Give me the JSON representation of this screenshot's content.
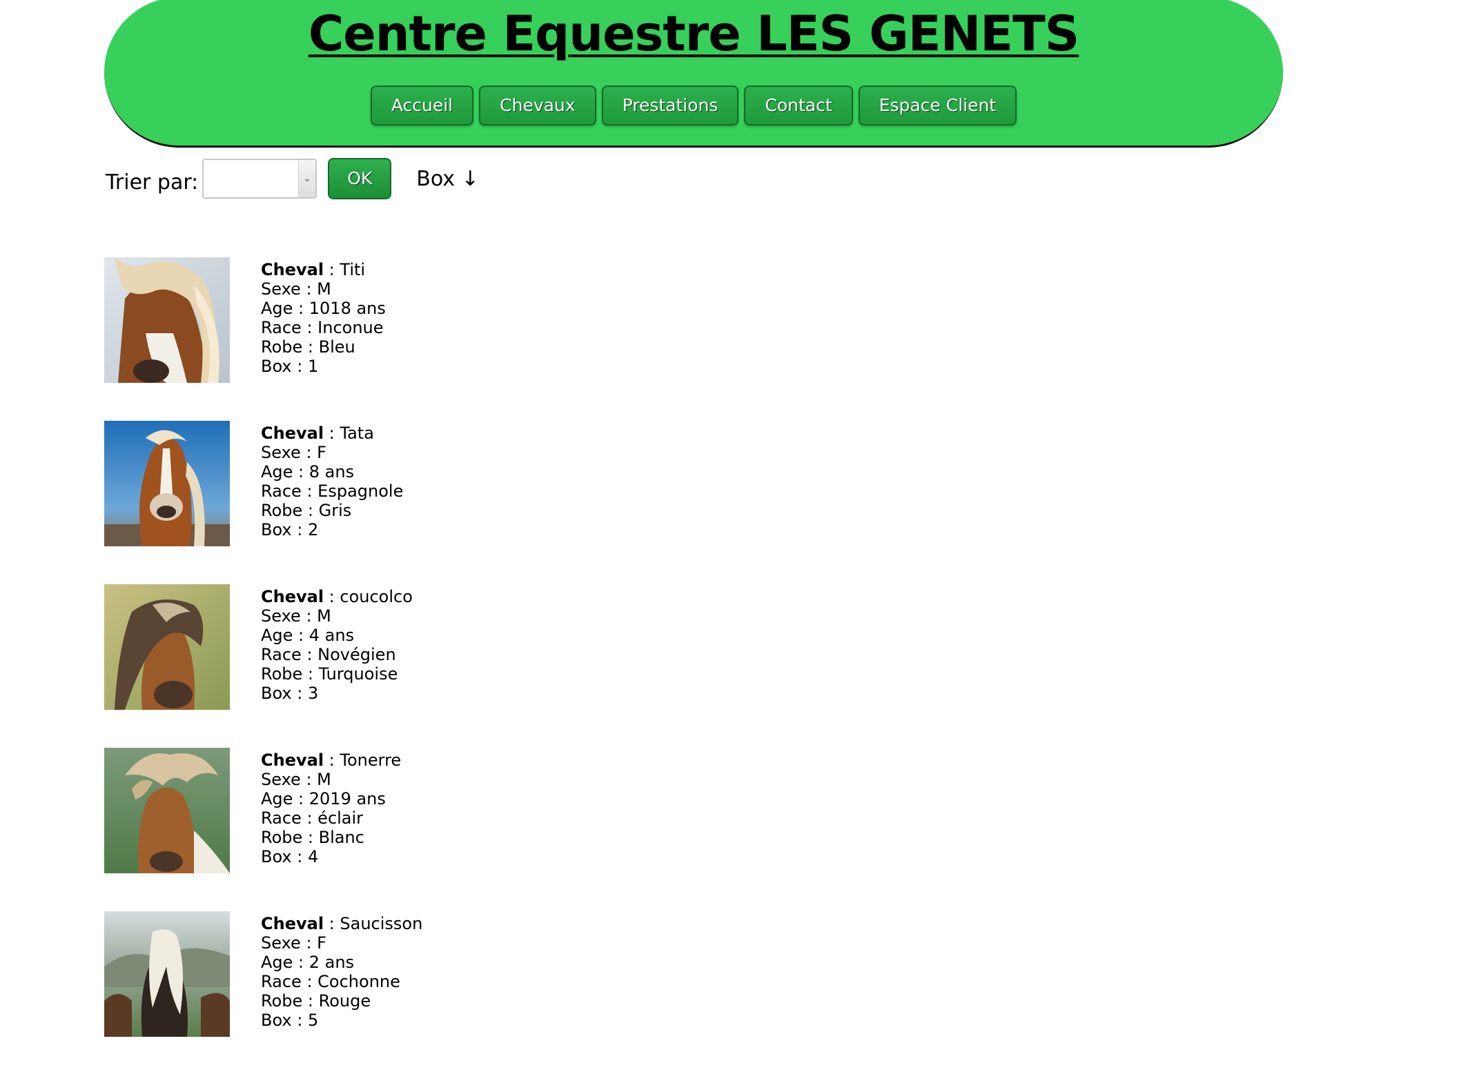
{
  "header": {
    "title": "Centre Equestre LES GENETS",
    "nav": [
      {
        "label": "Accueil"
      },
      {
        "label": "Chevaux"
      },
      {
        "label": "Prestations"
      },
      {
        "label": "Contact"
      },
      {
        "label": "Espace Client"
      }
    ],
    "colors": {
      "banner": "#36d05a",
      "button": "#1f9a3b"
    }
  },
  "sort": {
    "label": "Trier par:",
    "selected": "",
    "ok_label": "OK",
    "current": "Box ↓"
  },
  "horses": [
    {
      "name_label": "Cheval",
      "name": "Titi",
      "sexe": "M",
      "age": "1018 ans",
      "race": "Inconue",
      "robe": "Bleu",
      "box": "1",
      "photo_icon": "horse-photo-chestnut-blond-mane"
    },
    {
      "name_label": "Cheval",
      "name": "Tata",
      "sexe": "F",
      "age": "8 ans",
      "race": "Espagnole",
      "robe": "Gris",
      "box": "2",
      "photo_icon": "horse-photo-laughing-blue-sky"
    },
    {
      "name_label": "Cheval",
      "name": "coucolco",
      "sexe": "M",
      "age": "4 ans",
      "race": "Novégien",
      "robe": "Turquoise",
      "box": "3",
      "photo_icon": "horse-photo-icelandic-brown"
    },
    {
      "name_label": "Cheval",
      "name": "Tonerre",
      "sexe": "M",
      "age": "2019 ans",
      "race": "éclair",
      "robe": "Blanc",
      "box": "4",
      "photo_icon": "horse-photo-windblown-mane"
    },
    {
      "name_label": "Cheval",
      "name": "Saucisson",
      "sexe": "F",
      "age": "2 ans",
      "race": "Cochonne",
      "robe": "Rouge",
      "box": "5",
      "photo_icon": "horse-photo-dark-white-mane-mountains"
    }
  ]
}
